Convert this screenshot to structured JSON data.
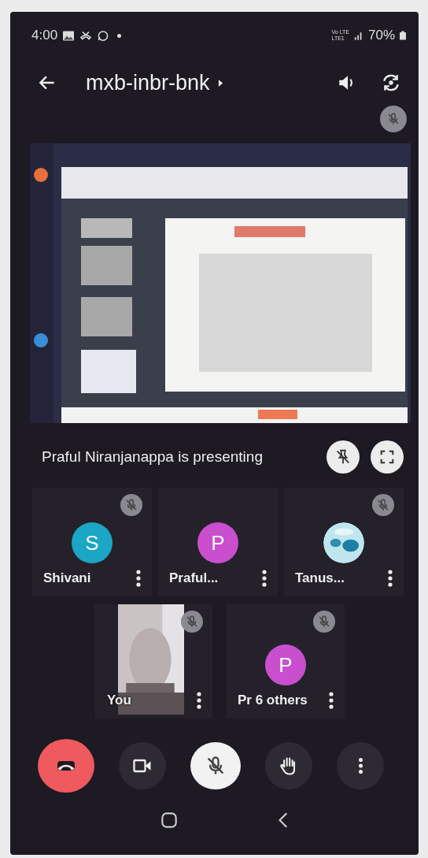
{
  "status_bar": {
    "time": "4:00",
    "network_labels": [
      "Vo LTE",
      "LTE1"
    ],
    "battery": "70%"
  },
  "header": {
    "title": "mxb-inbr-bnk",
    "presenter_muted": true
  },
  "presentation": {
    "kind": "picture",
    "caption": "Praful Niranjanappa is presenting"
  },
  "participants": [
    {
      "name": "Shivani",
      "kind": "initial",
      "initial": "S",
      "color": "#1aa6c4",
      "muted": true
    },
    {
      "name": "Praful...",
      "kind": "initial",
      "initial": "P",
      "color": "#c94fcf",
      "muted": false
    },
    {
      "name": "Tanus...",
      "kind": "picture",
      "muted": true
    },
    {
      "name": "You",
      "kind": "video",
      "muted": true
    },
    {
      "name": "Pr 6 others",
      "kind": "initial",
      "initial": "P",
      "color": "#c94fcf",
      "muted": true
    }
  ],
  "controls": [
    {
      "kind": "end-call"
    },
    {
      "kind": "camera",
      "on": true
    },
    {
      "kind": "microphone",
      "on": false
    },
    {
      "kind": "raise-hand"
    },
    {
      "kind": "more"
    }
  ]
}
